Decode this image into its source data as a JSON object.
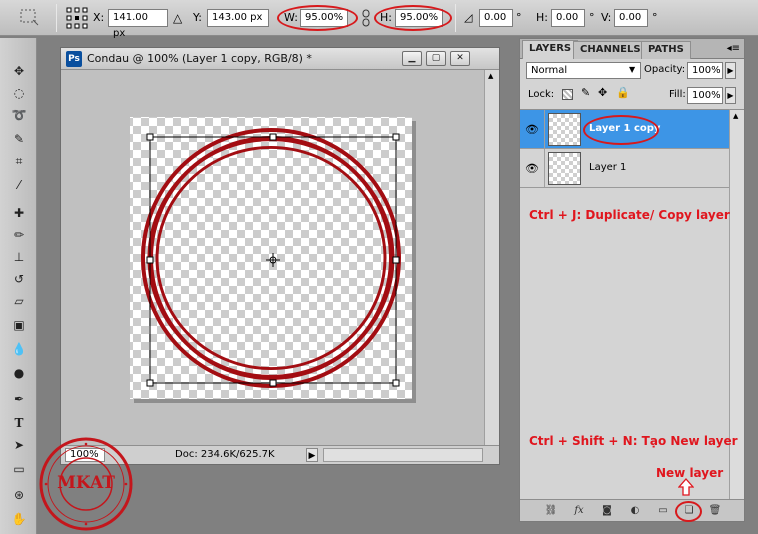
{
  "options_bar": {
    "x_label": "X:",
    "x_value": "141.00 px",
    "y_label": "Y:",
    "y_value": "143.00 px",
    "w_label": "W:",
    "w_value": "95.00%",
    "h_label": "H:",
    "h_value": "95.00%",
    "rotation_value": "0.00",
    "rotation_unit": "°",
    "hskew_label": "H:",
    "hskew_value": "0.00",
    "hskew_unit": "°",
    "vskew_label": "V:",
    "vskew_value": "0.00",
    "vskew_unit": "°"
  },
  "document": {
    "app_badge": "Ps",
    "title": "Condau @ 100% (Layer 1 copy, RGB/8) *",
    "zoom": "100%",
    "doc_info": "Doc: 234.6K/625.7K",
    "circle_color": "#a30d12"
  },
  "layers_panel": {
    "tabs": [
      {
        "label": "LAYERS"
      },
      {
        "label": "CHANNELS"
      },
      {
        "label": "PATHS"
      }
    ],
    "blend_mode": "Normal",
    "opacity_label": "Opacity:",
    "opacity_value": "100%",
    "lock_label": "Lock:",
    "fill_label": "Fill:",
    "fill_value": "100%",
    "layers": [
      {
        "name": "Layer 1 copy",
        "selected": true
      },
      {
        "name": "Layer 1",
        "selected": false
      }
    ],
    "selection_color": "#3d95e6"
  },
  "annotations": {
    "duplicate_hint": "Ctrl + J: Duplicate/ Copy layer",
    "new_layer_hint": "Ctrl + Shift + N: Tạo New layer",
    "new_layer_label": "New layer",
    "highlight_color": "#e0161e"
  },
  "stamp": {
    "text": "MKAT"
  }
}
